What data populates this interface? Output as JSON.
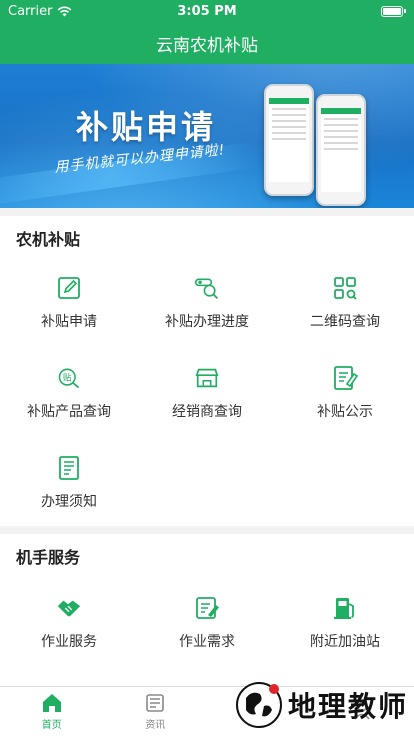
{
  "status_bar": {
    "carrier": "Carrier",
    "time": "3:05 PM"
  },
  "nav": {
    "title": "云南农机补贴"
  },
  "banner": {
    "title": "补贴申请",
    "subtitle": "用手机就可以办理申请啦!"
  },
  "sections": {
    "farm_subsidy": {
      "title": "农机补贴",
      "items": [
        {
          "label": "补贴申请",
          "icon": "edit-icon"
        },
        {
          "label": "补贴办理进度",
          "icon": "progress-search-icon"
        },
        {
          "label": "二维码查询",
          "icon": "qr-code-icon"
        },
        {
          "label": "补贴产品查询",
          "icon": "subsidy-search-icon"
        },
        {
          "label": "经销商查询",
          "icon": "store-icon"
        },
        {
          "label": "补贴公示",
          "icon": "notice-icon"
        },
        {
          "label": "办理须知",
          "icon": "guide-icon"
        }
      ]
    },
    "operator_services": {
      "title": "机手服务",
      "items": [
        {
          "label": "作业服务",
          "icon": "handshake-icon"
        },
        {
          "label": "作业需求",
          "icon": "demand-icon"
        },
        {
          "label": "附近加油站",
          "icon": "gas-station-icon"
        }
      ]
    }
  },
  "tabbar": {
    "tabs": [
      {
        "label": "首页",
        "icon": "home-icon",
        "active": true
      },
      {
        "label": "资讯",
        "icon": "news-icon",
        "active": false
      },
      {
        "label": "",
        "icon": "service-icon",
        "active": false
      },
      {
        "label": "",
        "icon": "profile-icon",
        "active": false
      }
    ]
  },
  "watermark": {
    "text": "地理教师"
  },
  "colors": {
    "primary": "#1fae62",
    "banner": "#1a78cc"
  }
}
